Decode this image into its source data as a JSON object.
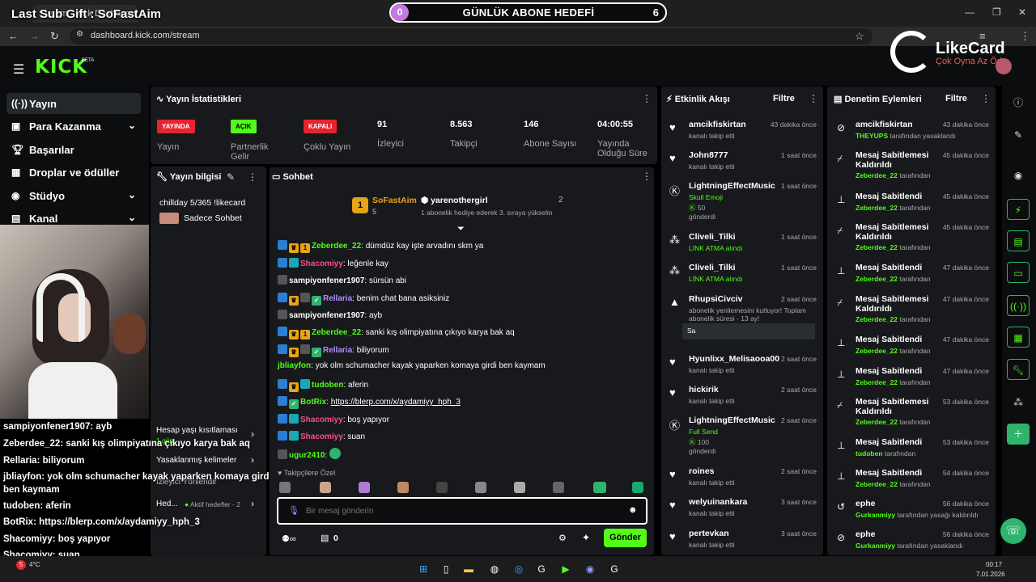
{
  "browser": {
    "tab_title": "Stream - Kick Dashboard",
    "url": "dashboard.kick.com/stream"
  },
  "overlay": {
    "last_sub": "Last Sub Gift : SoFastAim",
    "goal_start": "0",
    "goal_title": "GÜNLÜK ABONE HEDEFİ",
    "goal_end": "6",
    "likecard_name": "LikeCard",
    "likecard_tag": "Çok Oyna   Az Öde"
  },
  "nav": {
    "beta": "BETA"
  },
  "sidebar": {
    "items": [
      {
        "label": "Yayın",
        "icon": "broadcast-icon"
      },
      {
        "label": "Para Kazanma",
        "icon": "money-icon"
      },
      {
        "label": "Başarılar",
        "icon": "trophy-icon"
      },
      {
        "label": "Droplar ve ödüller",
        "icon": "gift-icon"
      },
      {
        "label": "Stüdyo",
        "icon": "studio-icon"
      },
      {
        "label": "Kanal",
        "icon": "channel-icon"
      }
    ]
  },
  "stats": {
    "title": "Yayın İstatistikleri",
    "items": [
      {
        "badge": "YAYINDA",
        "label": "Yayın",
        "color": "#e5242f"
      },
      {
        "badge": "AÇIK",
        "label": "Partnerlik Gelir",
        "color": "#53fc18"
      },
      {
        "badge": "KAPALI",
        "label": "Çoklu Yayın",
        "color": "#e5242f"
      },
      {
        "value": "91",
        "label": "İzleyici"
      },
      {
        "value": "8.563",
        "label": "Takipçi"
      },
      {
        "value": "146",
        "label": "Abone Sayısı"
      },
      {
        "value": "04:00:55",
        "label": "Yayında Olduğu Süre"
      }
    ]
  },
  "info": {
    "title": "Yayın bilgisi",
    "stream_title": "chillday 5/365 !likecard",
    "category": "Sadece Sohbet"
  },
  "settings": {
    "items": [
      {
        "label": "Hesap yaşı kısıtlaması",
        "sub": "1 gün"
      },
      {
        "label": "Yasaklanmış kelimeler"
      },
      {
        "label": "İzleyici Yönlendir"
      },
      {
        "label": "Hed...",
        "sub": "Aktif hedefler - 2"
      }
    ]
  },
  "chat": {
    "title": "Sohbet",
    "pinned": {
      "gifter": "SoFastAim",
      "gifter_count": "5",
      "recipient": "yarenothergirl",
      "recipient_count": "2",
      "note": "1 abonelik hediye ederek 3. sıraya yükselin"
    },
    "messages": [
      {
        "user": "Zeberdee_22",
        "text": "dümdüz kay işte arvadını skm ya",
        "color": "#53fc18"
      },
      {
        "user": "Shacomiyy",
        "text": "leğenle kay",
        "color": "#ff4c8a"
      },
      {
        "user": "sampiyonfener1907",
        "text": "sürsün abi",
        "color": "#fff"
      },
      {
        "user": "Rellaria",
        "text": "benim chat bana asiksiniz",
        "color": "#b28cff"
      },
      {
        "user": "sampiyonfener1907",
        "text": "ayb",
        "color": "#fff"
      },
      {
        "user": "Zeberdee_22",
        "text": "sanki kış olimpiyatına çıkıyo karya bak aq",
        "color": "#53fc18"
      },
      {
        "user": "Rellaria",
        "text": "biliyorum",
        "color": "#b28cff"
      },
      {
        "user": "jbliayfon",
        "text": "yok olm schumacher kayak yaparken komaya girdi ben kaymam",
        "color": "#53fc18"
      },
      {
        "user": "tudoben",
        "text": "aferin",
        "color": "#53fc18"
      },
      {
        "user": "BotRix",
        "text": "https://blerp.com/x/aydamiyy_hph_3",
        "color": "#53fc18"
      },
      {
        "user": "Shacomiyy",
        "text": "boş yapıyor",
        "color": "#ff4c8a"
      },
      {
        "user": "Shacomiyy",
        "text": "suan",
        "color": "#ff4c8a"
      },
      {
        "user": "ugur2410",
        "text": "",
        "color": "#53fc18"
      }
    ],
    "followers_only": "Takipçilere Özel",
    "placeholder": "Bir mesaj gönderin",
    "points": "0",
    "send": "Gönder"
  },
  "overlay_chat": [
    {
      "user": "sampiyonfener1907",
      "text": "ayb"
    },
    {
      "user": "Zeberdee_22",
      "text": "sanki kış olimpiyatına çıkıyo karya bak aq"
    },
    {
      "user": "Rellaria",
      "text": "biliyorum"
    },
    {
      "user": "jbliayfon",
      "text": "yok olm schumacher kayak yaparken komaya girdi"
    },
    {
      "user": "",
      "text": "ben kaymam"
    },
    {
      "user": "tudoben",
      "text": "aferin"
    },
    {
      "user": "BotRix",
      "text": "https://blerp.com/x/aydamiyy_hph_3"
    },
    {
      "user": "Shacomiyy",
      "text": "boş yapıyor"
    },
    {
      "user": "Shacomiyy",
      "text": "suan"
    },
    {
      "user": "ugur2410",
      "text": ""
    }
  ],
  "activity": {
    "title": "Etkinlik Akışı",
    "filter": "Filtre",
    "items": [
      {
        "name": "amcikfiskirtan",
        "sub": "kanalı takip etti",
        "time": "43 dakika önce",
        "icon": "heart-icon"
      },
      {
        "name": "John8777",
        "sub": "kanalı takip etti",
        "time": "1 saat önce",
        "icon": "heart-icon"
      },
      {
        "name": "LightningEffectMusic",
        "sub": "Skull Emoji",
        "extra": "50",
        "extra2": "gönderdi",
        "time": "1 saat önce",
        "icon": "kick-coin-icon"
      },
      {
        "name": "Cliveli_Tilki",
        "sub": "LİNK ATMA alındı",
        "time": "1 saat önce",
        "icon": "redeem-icon"
      },
      {
        "name": "Cliveli_Tilki",
        "sub": "LİNK ATMA alındı",
        "time": "1 saat önce",
        "icon": "redeem-icon"
      },
      {
        "name": "RhupsiCivciv",
        "sub": "abonelik yenilemesini kutluyor! Toplam abonelik süresi - 13 ay!",
        "extra": "Sa",
        "time": "2 saat önce",
        "icon": "sub-icon"
      },
      {
        "name": "Hyunlixx_Melisaooa00",
        "sub": "kanalı takip etti",
        "time": "2 saat önce",
        "icon": "heart-icon"
      },
      {
        "name": "hickirik",
        "sub": "kanalı takip etti",
        "time": "2 saat önce",
        "icon": "heart-icon"
      },
      {
        "name": "LightningEffectMusic",
        "sub": "Full Send",
        "extra": "100",
        "extra2": "gönderdi",
        "time": "2 saat önce",
        "icon": "kick-coin-icon"
      },
      {
        "name": "roines",
        "sub": "kanalı takip etti",
        "time": "2 saat önce",
        "icon": "heart-icon"
      },
      {
        "name": "welyuinankara",
        "sub": "kanalı takip etti",
        "time": "3 saat önce",
        "icon": "heart-icon"
      },
      {
        "name": "pertevkan",
        "sub": "kanalı takip etti",
        "time": "3 saat önce",
        "icon": "heart-icon"
      }
    ]
  },
  "moderation": {
    "title": "Denetim Eylemleri",
    "filter": "Filtre",
    "items": [
      {
        "name": "amcikfiskirtan",
        "by": "THEYUPS",
        "suffix": "tarafından yasaklandı",
        "time": "43 dakika önce"
      },
      {
        "name": "Mesaj Sabitlemesi Kaldırıldı",
        "by": "Zeberdee_22",
        "suffix": "tarafından",
        "time": "45 dakika önce"
      },
      {
        "name": "Mesaj Sabitlendi",
        "by": "Zeberdee_22",
        "suffix": "tarafından",
        "time": "45 dakika önce"
      },
      {
        "name": "Mesaj Sabitlemesi Kaldırıldı",
        "by": "Zeberdee_22",
        "suffix": "tarafından",
        "time": "45 dakika önce"
      },
      {
        "name": "Mesaj Sabitlendi",
        "by": "Zeberdee_22",
        "suffix": "tarafından",
        "time": "47 dakika önce"
      },
      {
        "name": "Mesaj Sabitlemesi Kaldırıldı",
        "by": "Zeberdee_22",
        "suffix": "tarafından",
        "time": "47 dakika önce"
      },
      {
        "name": "Mesaj Sabitlendi",
        "by": "Zeberdee_22",
        "suffix": "tarafından",
        "time": "47 dakika önce"
      },
      {
        "name": "Mesaj Sabitlendi",
        "by": "Zeberdee_22",
        "suffix": "tarafından",
        "time": "47 dakika önce"
      },
      {
        "name": "Mesaj Sabitlemesi Kaldırıldı",
        "by": "Zeberdee_22",
        "suffix": "tarafından",
        "time": "53 dakika önce"
      },
      {
        "name": "Mesaj Sabitlendi",
        "by": "tudoben",
        "suffix": "tarafından",
        "time": "53 dakika önce"
      },
      {
        "name": "Mesaj Sabitlendi",
        "by": "Zeberdee_22",
        "suffix": "tarafından",
        "time": "54 dakika önce"
      },
      {
        "name": "ephe",
        "by": "Gurkanmiyy",
        "suffix": "tarafından yasağı kaldırıldı",
        "time": "56 dakika önce"
      },
      {
        "name": "ephe",
        "by": "Gurkanmiyy",
        "suffix": "tarafından yasaklandı",
        "time": "56 dakika önce"
      }
    ]
  },
  "taskbar": {
    "weather": "4°C",
    "time": "00:17",
    "date": "7.01.2026"
  }
}
